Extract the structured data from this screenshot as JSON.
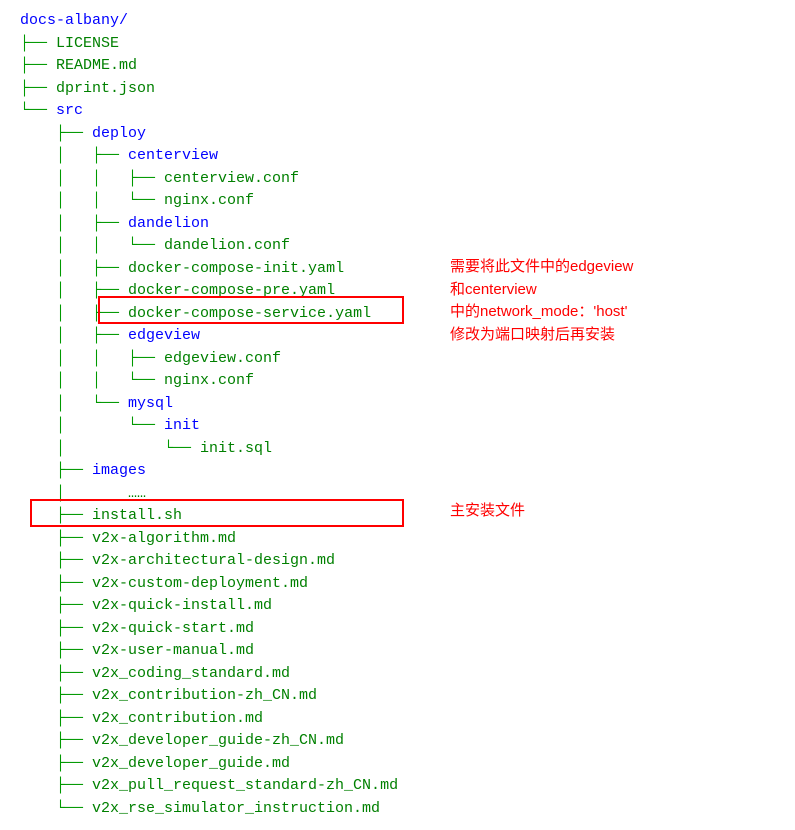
{
  "tree": {
    "root": "docs-albany/",
    "license": "LICENSE",
    "readme": "README.md",
    "dprint": "dprint.json",
    "src": "src",
    "deploy": "deploy",
    "centerview": "centerview",
    "centerview_conf": "centerview.conf",
    "centerview_nginx": "nginx.conf",
    "dandelion": "dandelion",
    "dandelion_conf": "dandelion.conf",
    "dc_init": "docker-compose-init.yaml",
    "dc_pre": "docker-compose-pre.yaml",
    "dc_service": "docker-compose-service.yaml",
    "edgeview": "edgeview",
    "edgeview_conf": "edgeview.conf",
    "edgeview_nginx": "nginx.conf",
    "mysql": "mysql",
    "mysql_init": "init",
    "init_sql": "init.sql",
    "images": "images",
    "ellipsis": "……",
    "install": "install.sh",
    "v2x_algorithm": "v2x-algorithm.md",
    "v2x_arch": "v2x-architectural-design.md",
    "v2x_custom": "v2x-custom-deployment.md",
    "v2x_quick_install": "v2x-quick-install.md",
    "v2x_quick_start": "v2x-quick-start.md",
    "v2x_user_manual": "v2x-user-manual.md",
    "v2x_coding": "v2x_coding_standard.md",
    "v2x_contrib_cn": "v2x_contribution-zh_CN.md",
    "v2x_contrib": "v2x_contribution.md",
    "v2x_dev_cn": "v2x_developer_guide-zh_CN.md",
    "v2x_dev": "v2x_developer_guide.md",
    "v2x_pr": "v2x_pull_request_standard-zh_CN.md",
    "v2x_rse": "v2x_rse_simulator_instruction.md"
  },
  "annotations": {
    "note1_line1": "需要将此文件中的edgeview",
    "note1_line2": "和centerview",
    "note1_line3": "中的network_mode：'host'",
    "note1_line4": "修改为端口映射后再安装",
    "note2": "主安装文件"
  }
}
